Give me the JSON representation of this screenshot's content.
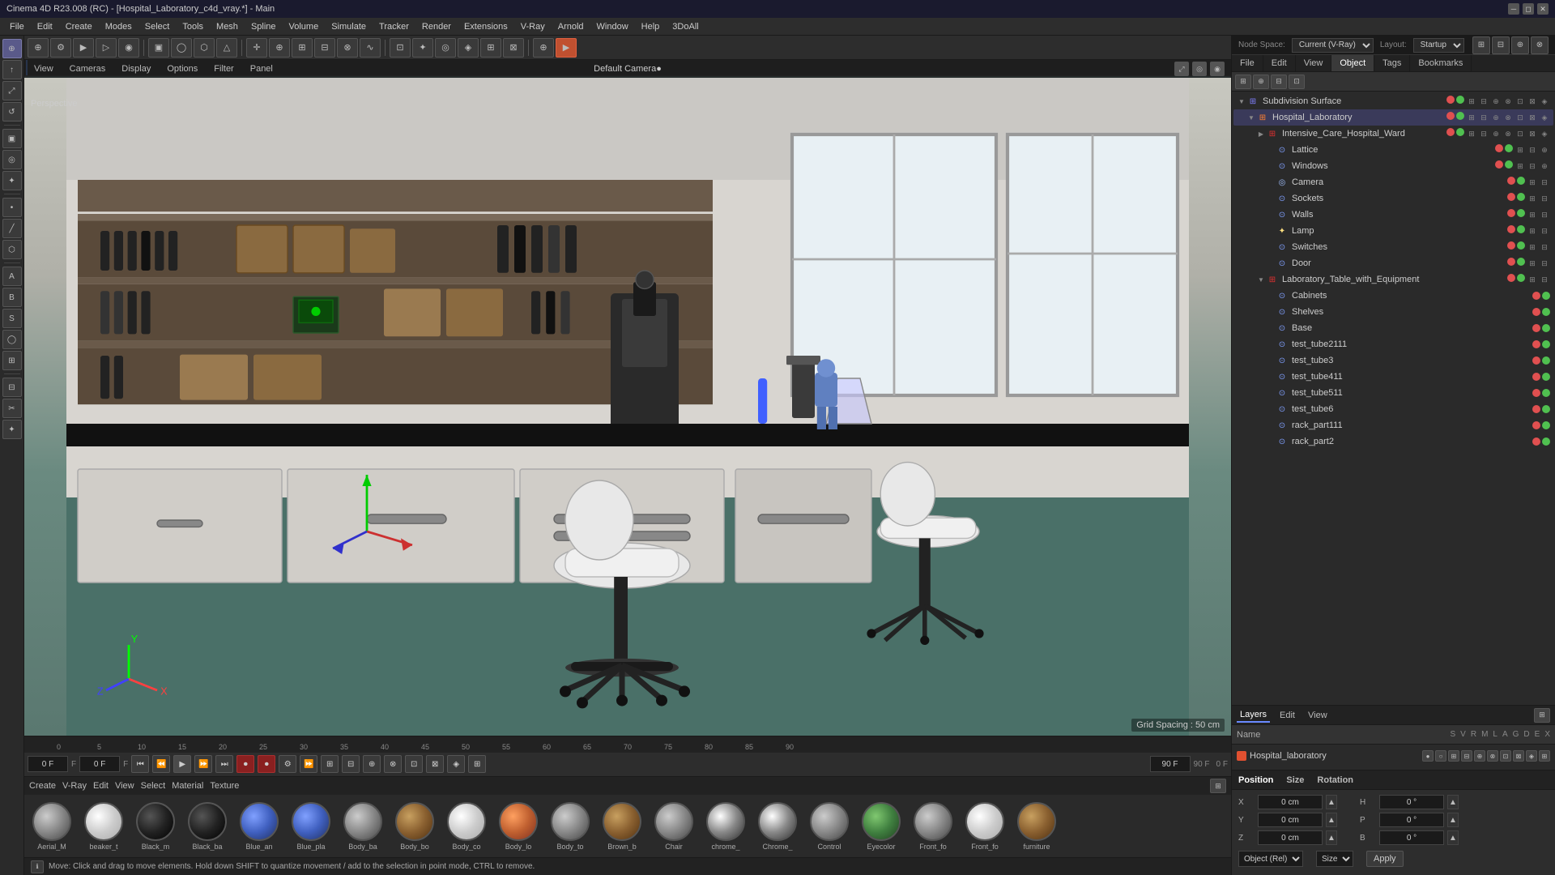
{
  "app": {
    "title": "Cinema 4D R23.008 (RC) - [Hospital_Laboratory_c4d_vray.*] - Main",
    "window_controls": [
      "minimize",
      "restore",
      "close"
    ]
  },
  "menubar": {
    "items": [
      "File",
      "Edit",
      "Create",
      "Modes",
      "Select",
      "Tools",
      "Mesh",
      "Spline",
      "Volume",
      "Simulate",
      "Tracker",
      "Render",
      "Extensions",
      "V-Ray",
      "Arnold",
      "Window",
      "Help",
      "3DoAll"
    ]
  },
  "viewport": {
    "menus": [
      "View",
      "Cameras",
      "Display",
      "Options",
      "Filter",
      "Panel"
    ],
    "camera_label": "Default Camera●",
    "perspective_label": "Perspective",
    "grid_info": "Grid Spacing : 50 cm",
    "icons": [
      "maximize",
      "camera-options",
      "viewport-solo"
    ]
  },
  "timeline": {
    "current_frame": "0 F",
    "start_frame": "0 F",
    "end_frame": "90 F",
    "fps": "90 F",
    "marks": [
      "0",
      "5",
      "10",
      "15",
      "20",
      "25",
      "30",
      "35",
      "40",
      "45",
      "50",
      "55",
      "60",
      "65",
      "70",
      "75",
      "80",
      "85",
      "90"
    ]
  },
  "node_space": {
    "label": "Node Space:",
    "value": "Current (V-Ray)",
    "layout_label": "Layout:",
    "layout_value": "Startup"
  },
  "right_panel": {
    "tabs": {
      "file": "File",
      "edit": "Edit",
      "view": "View",
      "object": "Object",
      "tags": "Tags",
      "bookmarks": "Bookmarks"
    }
  },
  "object_tree": {
    "root": "Subdivision Surface",
    "items": [
      {
        "name": "Hospital_Laboratory",
        "level": 1,
        "icon": "folder",
        "color": "orange",
        "expanded": true
      },
      {
        "name": "Intensive_Care_Hospital_Ward",
        "level": 2,
        "icon": "folder",
        "color": "red",
        "expanded": false
      },
      {
        "name": "Lattice",
        "level": 3,
        "icon": "object",
        "expanded": false
      },
      {
        "name": "Windows",
        "level": 3,
        "icon": "object",
        "expanded": false
      },
      {
        "name": "Camera",
        "level": 3,
        "icon": "camera",
        "expanded": false
      },
      {
        "name": "Sockets",
        "level": 3,
        "icon": "object",
        "expanded": false
      },
      {
        "name": "Walls",
        "level": 3,
        "icon": "object",
        "expanded": false
      },
      {
        "name": "Lamp",
        "level": 3,
        "icon": "light",
        "expanded": false
      },
      {
        "name": "Switches",
        "level": 3,
        "icon": "object",
        "expanded": false
      },
      {
        "name": "Door",
        "level": 3,
        "icon": "object",
        "expanded": false
      },
      {
        "name": "Laboratory_Table_with_Equipment",
        "level": 2,
        "icon": "folder",
        "color": "red",
        "expanded": true
      },
      {
        "name": "Cabinets",
        "level": 3,
        "icon": "object",
        "expanded": false
      },
      {
        "name": "Shelves",
        "level": 3,
        "icon": "object",
        "expanded": false
      },
      {
        "name": "Base",
        "level": 3,
        "icon": "object",
        "expanded": false
      },
      {
        "name": "test_tube2111",
        "level": 3,
        "icon": "object",
        "expanded": false
      },
      {
        "name": "test_tube3",
        "level": 3,
        "icon": "object",
        "expanded": false
      },
      {
        "name": "test_tube411",
        "level": 3,
        "icon": "object",
        "expanded": false
      },
      {
        "name": "test_tube511",
        "level": 3,
        "icon": "object",
        "expanded": false
      },
      {
        "name": "test_tube6",
        "level": 3,
        "icon": "object",
        "expanded": false
      },
      {
        "name": "rack_part111",
        "level": 3,
        "icon": "object",
        "expanded": false
      },
      {
        "name": "rack_part2",
        "level": 3,
        "icon": "object",
        "expanded": false
      }
    ]
  },
  "layers": {
    "tabs": [
      "Layers",
      "Edit",
      "View"
    ],
    "active_tab": "Layers",
    "name_label": "Name",
    "flags": [
      "S",
      "V",
      "R",
      "M",
      "L",
      "A",
      "G",
      "D",
      "E",
      "X"
    ],
    "items": [
      {
        "name": "Hospital_laboratory",
        "color": "#e05030"
      }
    ]
  },
  "properties": {
    "sections": [
      "Position",
      "Size",
      "Rotation"
    ],
    "position": {
      "x_label": "X",
      "x_value": "0 cm",
      "y_label": "Y",
      "y_value": "0 cm",
      "z_label": "Z",
      "z_value": "0 cm"
    },
    "size": {
      "x_label": "H",
      "x_value": "0 °",
      "y_label": "P",
      "y_value": "0 °",
      "z_label": "B",
      "z_value": "0 °"
    },
    "mode_label": "Object (Rel)",
    "size_mode": "Size",
    "apply_label": "Apply"
  },
  "materials": {
    "menus": [
      "Create",
      "V-Ray",
      "Edit",
      "View",
      "Select",
      "Material",
      "Texture"
    ],
    "items": [
      {
        "name": "Aerial_M",
        "color_class": "mat-gray"
      },
      {
        "name": "beaker_t",
        "color_class": "mat-white"
      },
      {
        "name": "Black_m",
        "color_class": "mat-black"
      },
      {
        "name": "Black_ba",
        "color_class": "mat-black"
      },
      {
        "name": "Blue_an",
        "color_class": "mat-blue"
      },
      {
        "name": "Blue_pla",
        "color_class": "mat-blue"
      },
      {
        "name": "Body_ba",
        "color_class": "mat-gray"
      },
      {
        "name": "Body_bo",
        "color_class": "mat-brown"
      },
      {
        "name": "Body_co",
        "color_class": "mat-white"
      },
      {
        "name": "Body_lo",
        "color_class": "mat-orange"
      },
      {
        "name": "Body_to",
        "color_class": "mat-gray"
      },
      {
        "name": "Brown_b",
        "color_class": "mat-brown"
      },
      {
        "name": "Chair",
        "color_class": "mat-gray"
      },
      {
        "name": "chrome_",
        "color_class": "mat-chrome"
      },
      {
        "name": "Chrome_",
        "color_class": "mat-chrome"
      },
      {
        "name": "Control",
        "color_class": "mat-gray"
      },
      {
        "name": "Eyecolor",
        "color_class": "mat-green"
      },
      {
        "name": "Front_fo",
        "color_class": "mat-gray"
      },
      {
        "name": "Front_fo",
        "color_class": "mat-white"
      },
      {
        "name": "furniture",
        "color_class": "mat-brown"
      }
    ]
  },
  "statusbar": {
    "message": "Move: Click and drag to move elements. Hold down SHIFT to quantize movement / add to the selection in point mode, CTRL to remove."
  }
}
